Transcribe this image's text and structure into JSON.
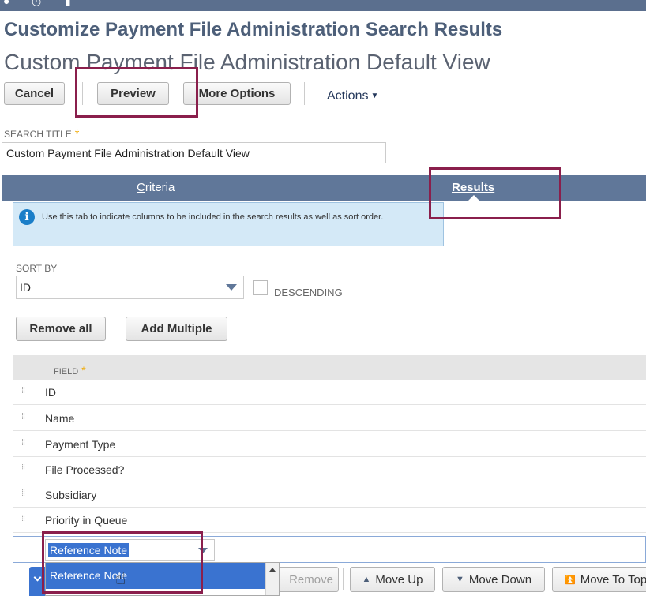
{
  "header": {
    "title": "Customize Payment File Administration Search Results",
    "subtitle": "Custom Payment File Administration Default View"
  },
  "toolbar": {
    "cancel_label": "Cancel",
    "preview_label": "Preview",
    "more_options_label": "More Options",
    "actions_label": "Actions"
  },
  "search_title": {
    "label": "SEARCH TITLE",
    "required_mark": "*",
    "value": "Custom Payment File Administration Default View"
  },
  "tabs": [
    {
      "label_first": "C",
      "label_rest": "riteria",
      "active": false
    },
    {
      "label_first": "R",
      "label_rest": "esults",
      "active": true
    }
  ],
  "info": {
    "text": "Use this tab to indicate columns to be included in the search results as well as sort order."
  },
  "sort": {
    "label": "SORT BY",
    "value": "ID",
    "descending_label": "DESCENDING",
    "descending_checked": false
  },
  "buttons": {
    "remove_all": "Remove all",
    "add_multiple": "Add Multiple"
  },
  "grid": {
    "field_header": "FIELD",
    "required_mark": "*",
    "rows": [
      "ID",
      "Name",
      "Payment Type",
      "File Processed?",
      "Subsidiary",
      "Priority in Queue"
    ],
    "editing_value": "Reference Note"
  },
  "dropdown": {
    "options": [
      "Reference Note"
    ]
  },
  "row_buttons": {
    "remove": "Remove",
    "move_up": "Move Up",
    "move_down": "Move Down",
    "move_to_top": "Move To Top"
  },
  "colors": {
    "tab_bar": "#607799",
    "highlight_box": "#8a1f4c",
    "selection_blue": "#3a73d0",
    "title_blue": "#4d5f79"
  }
}
